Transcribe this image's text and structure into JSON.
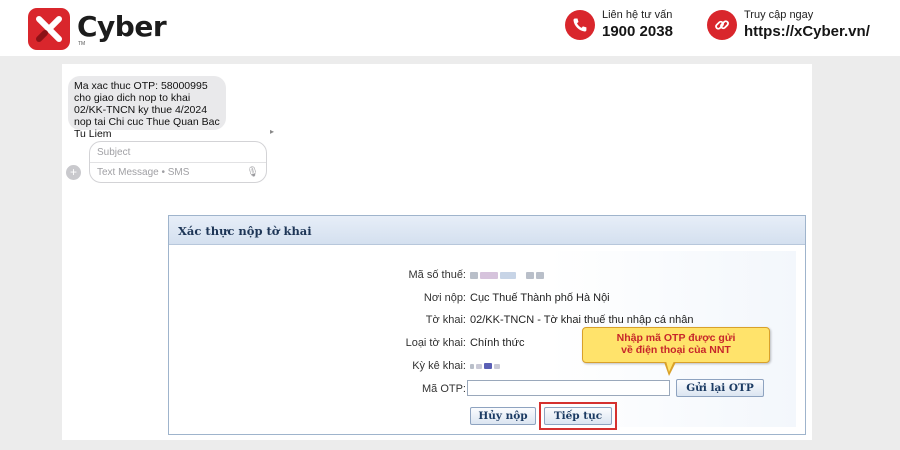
{
  "brand": {
    "name": "Cyber",
    "trademark": "TM",
    "accent_color": "#d9262c"
  },
  "contacts": [
    {
      "label": "Liên hệ tư vấn",
      "value": "1900 2038",
      "icon": "phone-icon"
    },
    {
      "label": "Truy cập ngay",
      "value": "https://xCyber.vn/",
      "icon": "link-icon"
    }
  ],
  "sms": {
    "message": "Ma xac thuc OTP: 58000995 cho giao dich nop to khai 02/KK-TNCN ky thue 4/2024 nop tai Chi cuc Thue Quan Bac Tu Liem",
    "subject_placeholder": "Subject",
    "message_placeholder": "Text Message • SMS"
  },
  "form": {
    "title": "Xác thực nộp tờ khai",
    "fields": [
      {
        "label": "Mã số thuế:",
        "value": ""
      },
      {
        "label": "Nơi nộp:",
        "value": "Cục Thuế Thành phố Hà Nội"
      },
      {
        "label": "Tờ khai:",
        "value": "02/KK-TNCN - Tờ khai thuế thu nhập cá nhân"
      },
      {
        "label": "Loại tờ khai:",
        "value": "Chính thức"
      },
      {
        "label": "Kỳ kê khai:",
        "value": ""
      }
    ],
    "otp_label": "Mã OTP:",
    "otp_value": "",
    "resend_button": "Gửi lại OTP",
    "cancel_button": "Hủy nộp",
    "continue_button": "Tiếp tục"
  },
  "callout": {
    "line1": "Nhập mã OTP được gửi",
    "line2": "về điện thoại của NNT"
  }
}
